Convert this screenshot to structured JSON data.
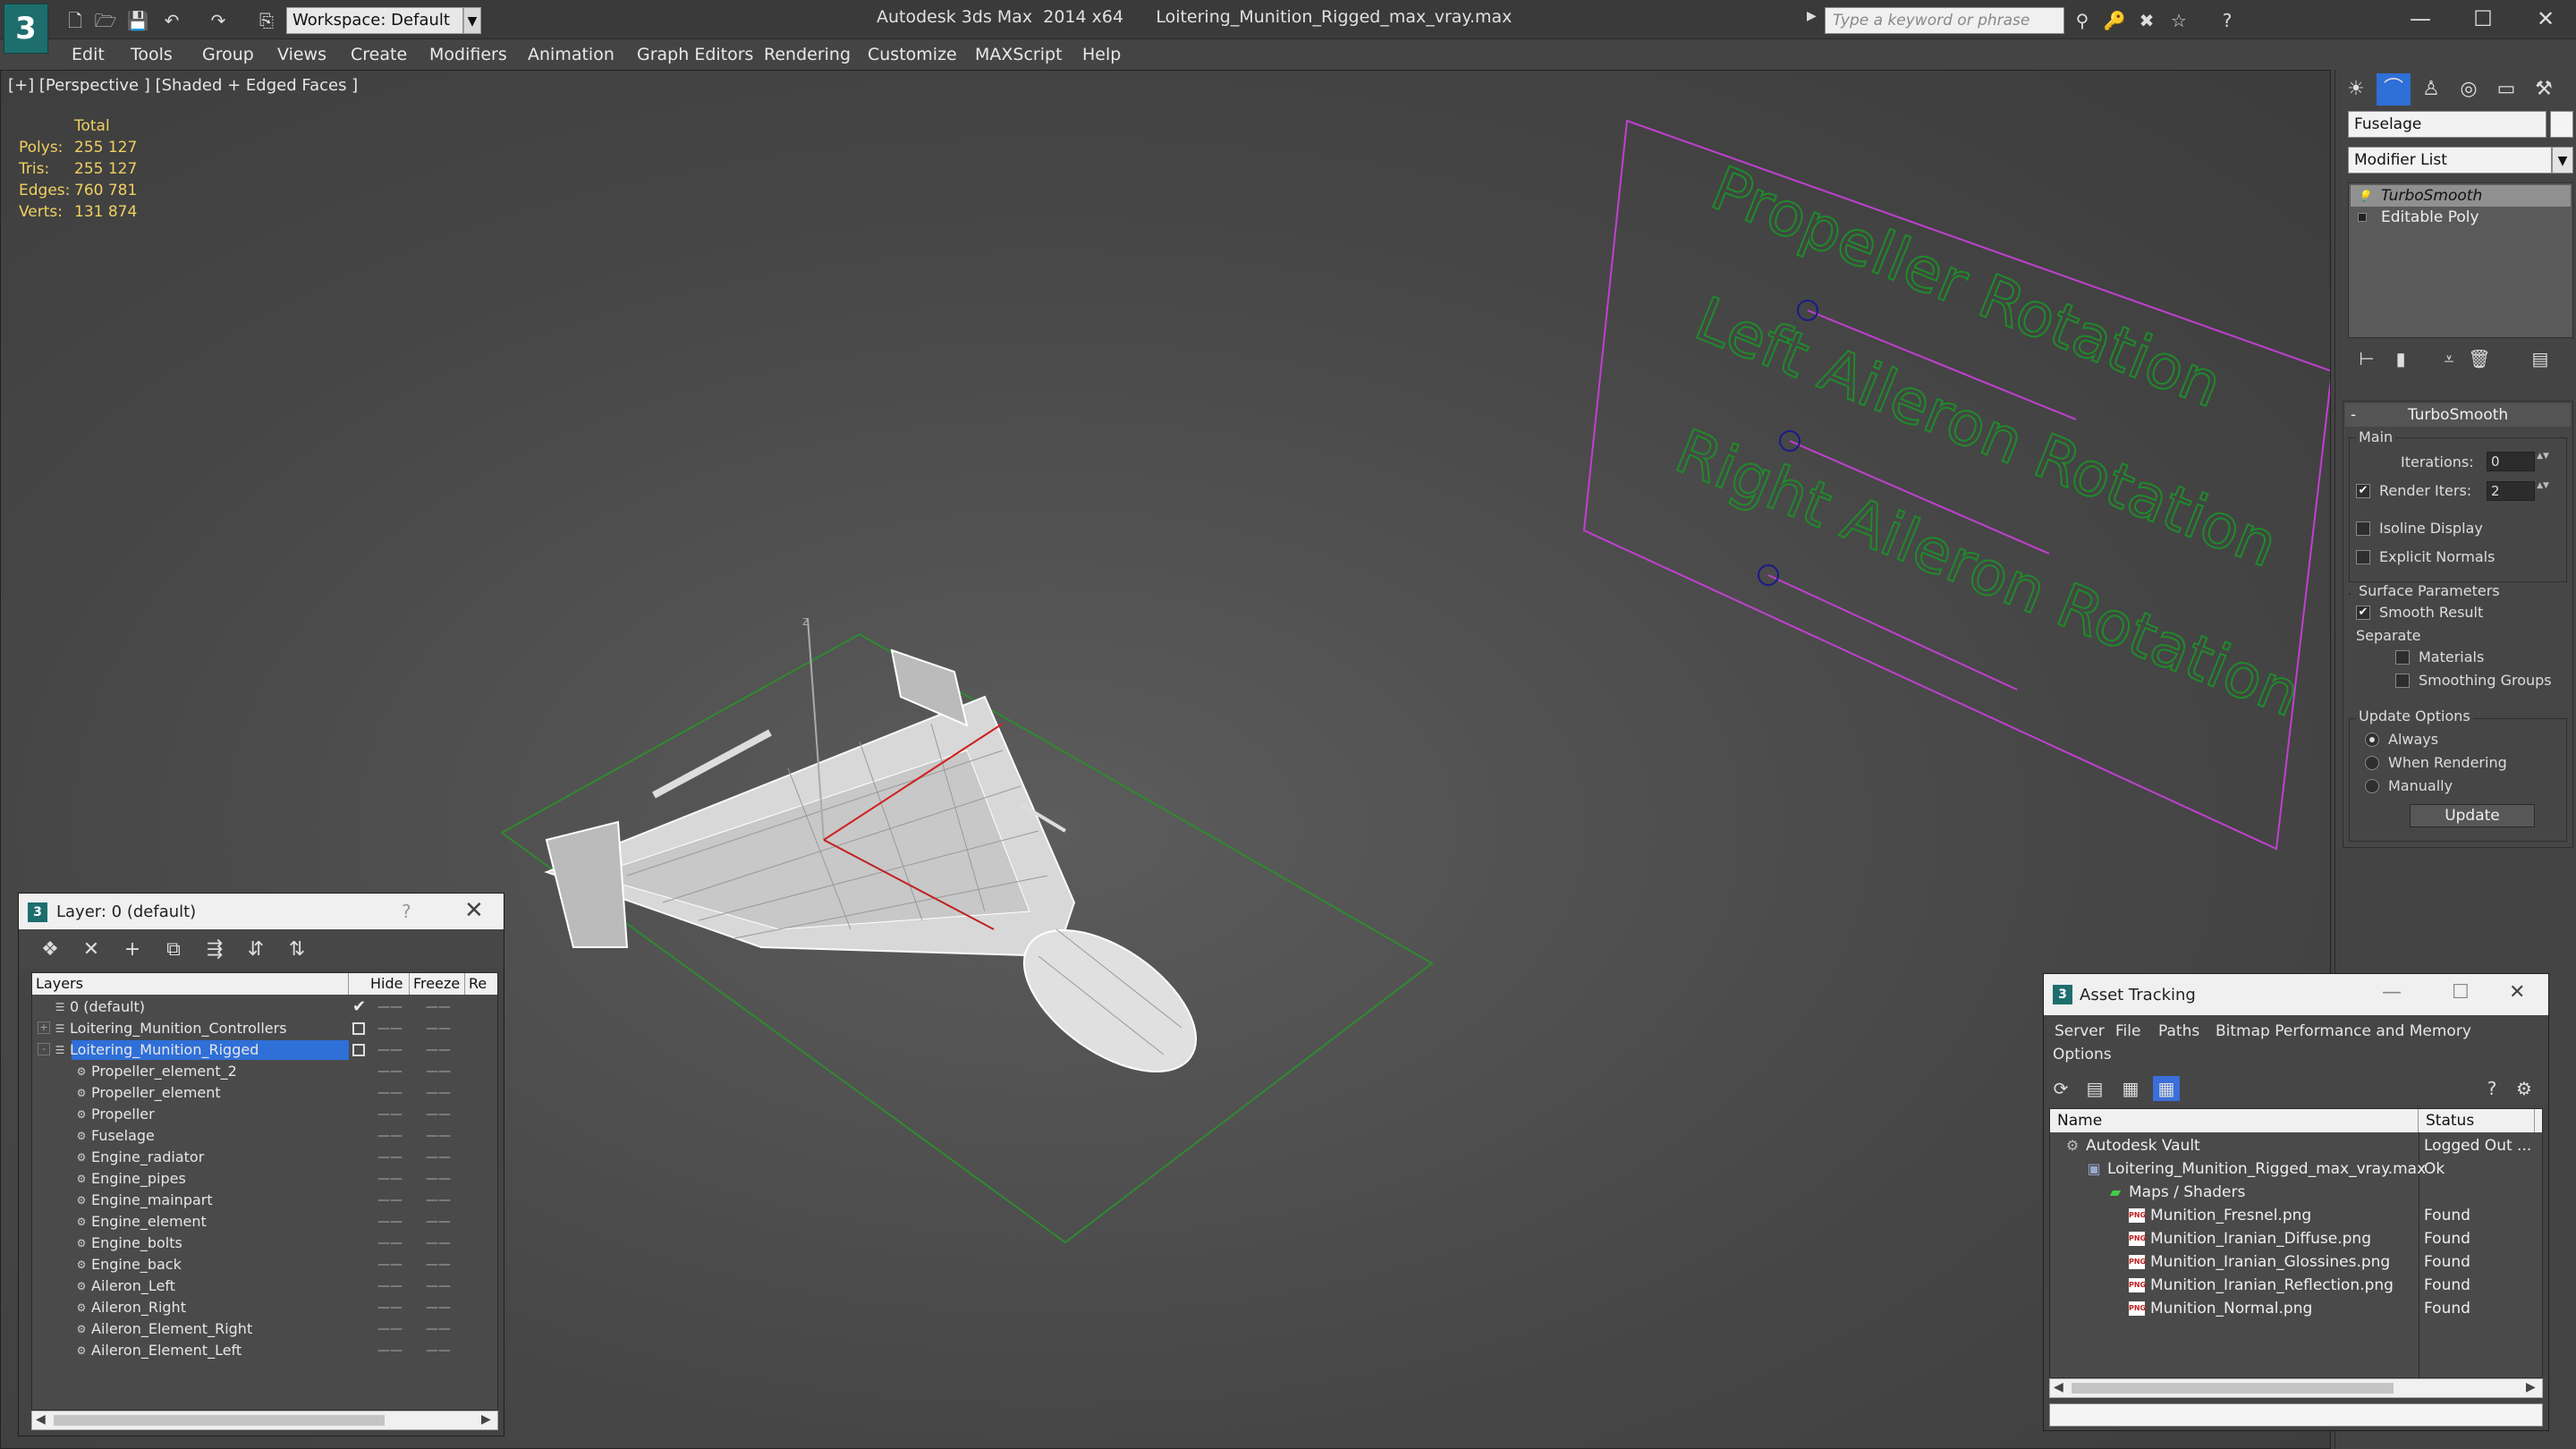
{
  "titlebar": {
    "logo_glyph": "3",
    "app_name": "Autodesk 3ds Max  2014 x64",
    "file_name": "Loitering_Munition_Rigged_max_vray.max",
    "workspace_label": "Workspace: Default",
    "search_placeholder": "Type a keyword or phrase",
    "icons": {
      "new": "🗋",
      "open": "🗁",
      "save": "💾",
      "undo": "↶",
      "redo": "↷",
      "project": "⎘",
      "search_binoculars": "⚲",
      "subscription": "🔑",
      "exchange": "✖",
      "favorites": "☆",
      "help": "?",
      "minimize": "—",
      "maximize": "☐",
      "close": "✕"
    }
  },
  "menubar": {
    "items": [
      "Edit",
      "Tools",
      "Group",
      "Views",
      "Create",
      "Modifiers",
      "Animation",
      "Graph Editors",
      "Rendering",
      "Customize",
      "MAXScript",
      "Help"
    ]
  },
  "viewport": {
    "label": "[+] [Perspective ] [Shaded + Edged Faces ]",
    "stats": {
      "header": "Total",
      "rows": [
        {
          "label": "Polys:",
          "value": "255 127"
        },
        {
          "label": "Tris:",
          "value": "255 127"
        },
        {
          "label": "Edges:",
          "value": "760 781"
        },
        {
          "label": "Verts:",
          "value": "131 874"
        }
      ]
    },
    "gizmo_axis_label": "z",
    "controller_labels": [
      "Propeller Rotation",
      "Left Aileron Rotation",
      "Right Aileron Rotation"
    ]
  },
  "command_panel": {
    "tab_icons": [
      "☀",
      "⌒",
      "♙",
      "◎",
      "▭",
      "⚒"
    ],
    "object_name": "Fuselage",
    "modifier_list": "Modifier List",
    "stack": [
      {
        "name": "TurboSmooth",
        "selected": true
      },
      {
        "name": "Editable Poly",
        "selected": false
      }
    ],
    "stack_tool_icons": [
      "⊢",
      "▮",
      "⩡",
      "🗑",
      "▤"
    ],
    "rollout": {
      "collapse": "-",
      "title": "TurboSmooth",
      "main_group": "Main",
      "iterations_label": "Iterations:",
      "iterations_value": "0",
      "render_iters_label": "Render Iters:",
      "render_iters_value": "2",
      "render_iters_checked": true,
      "isoline_display": "Isoline Display",
      "explicit_normals": "Explicit Normals",
      "surface_group": "Surface Parameters",
      "smooth_result": "Smooth Result",
      "smooth_result_checked": true,
      "separate_label": "Separate",
      "materials": "Materials",
      "smoothing_groups": "Smoothing Groups",
      "update_group": "Update Options",
      "always": "Always",
      "when_rendering": "When Rendering",
      "manually": "Manually",
      "update_button": "Update",
      "spinner_arrows": "▲▼"
    }
  },
  "layer_dialog": {
    "title": "Layer: 0 (default)",
    "help_glyph": "?",
    "close_glyph": "✕",
    "toolbar_icons": [
      "❖",
      "✕",
      "+",
      "⧉",
      "⇶",
      "⇵",
      "⇅"
    ],
    "columns": [
      "Layers",
      "Hide",
      "Freeze",
      "Re"
    ],
    "hide_mark": "——",
    "current_check": "✔",
    "rows": [
      {
        "name": "0 (default)",
        "level": 0,
        "kind": "layer",
        "current": "check"
      },
      {
        "name": "Loitering_Munition_Controllers",
        "level": 0,
        "kind": "layer",
        "expand": "+",
        "current": "box"
      },
      {
        "name": "Loitering_Munition_Rigged",
        "level": 0,
        "kind": "layer",
        "expand": "-",
        "current": "box",
        "selected": true
      },
      {
        "name": "Propeller_element_2",
        "level": 1,
        "kind": "object"
      },
      {
        "name": "Propeller_element",
        "level": 1,
        "kind": "object"
      },
      {
        "name": "Propeller",
        "level": 1,
        "kind": "object"
      },
      {
        "name": "Fuselage",
        "level": 1,
        "kind": "object"
      },
      {
        "name": "Engine_radiator",
        "level": 1,
        "kind": "object"
      },
      {
        "name": "Engine_pipes",
        "level": 1,
        "kind": "object"
      },
      {
        "name": "Engine_mainpart",
        "level": 1,
        "kind": "object"
      },
      {
        "name": "Engine_element",
        "level": 1,
        "kind": "object"
      },
      {
        "name": "Engine_bolts",
        "level": 1,
        "kind": "object"
      },
      {
        "name": "Engine_back",
        "level": 1,
        "kind": "object"
      },
      {
        "name": "Aileron_Left",
        "level": 1,
        "kind": "object"
      },
      {
        "name": "Aileron_Right",
        "level": 1,
        "kind": "object"
      },
      {
        "name": "Aileron_Element_Right",
        "level": 1,
        "kind": "object"
      },
      {
        "name": "Aileron_Element_Left",
        "level": 1,
        "kind": "object"
      }
    ],
    "scroll_left": "◀",
    "scroll_right": "▶"
  },
  "asset_dialog": {
    "title": "Asset Tracking",
    "window_controls": [
      "—",
      "☐",
      "✕"
    ],
    "menu": [
      "Server",
      "File",
      "Paths",
      "Bitmap Performance and Memory",
      "Options"
    ],
    "toolbar_icons": [
      "⟳",
      "▤",
      "▦",
      "▦",
      "?",
      "⚙"
    ],
    "columns": [
      "Name",
      "Status"
    ],
    "rows": [
      {
        "name": "Autodesk Vault",
        "status": "Logged Out ...",
        "level": 0,
        "icon": "vault",
        "glyph": "⚙"
      },
      {
        "name": "Loitering_Munition_Rigged_max_vray.max",
        "status": "Ok",
        "level": 1,
        "icon": "file",
        "glyph": "▣"
      },
      {
        "name": "Maps / Shaders",
        "status": "",
        "level": 2,
        "icon": "maps",
        "glyph": "▰"
      },
      {
        "name": "Munition_Fresnel.png",
        "status": "Found",
        "level": 3,
        "icon": "png",
        "glyph": "PNG"
      },
      {
        "name": "Munition_Iranian_Diffuse.png",
        "status": "Found",
        "level": 3,
        "icon": "png",
        "glyph": "PNG"
      },
      {
        "name": "Munition_Iranian_Glossines.png",
        "status": "Found",
        "level": 3,
        "icon": "png",
        "glyph": "PNG"
      },
      {
        "name": "Munition_Iranian_Reflection.png",
        "status": "Found",
        "level": 3,
        "icon": "png",
        "glyph": "PNG"
      },
      {
        "name": "Munition_Normal.png",
        "status": "Found",
        "level": 3,
        "icon": "png",
        "glyph": "PNG"
      }
    ],
    "scroll_left": "◀",
    "scroll_right": "▶"
  },
  "colors": {
    "stats_text": "#f0d060",
    "controller_text": "#1f8a2a",
    "controller_frame": "#c040d0",
    "selection_blue": "#2f6fd8",
    "grid_green": "#2f8a2f"
  }
}
